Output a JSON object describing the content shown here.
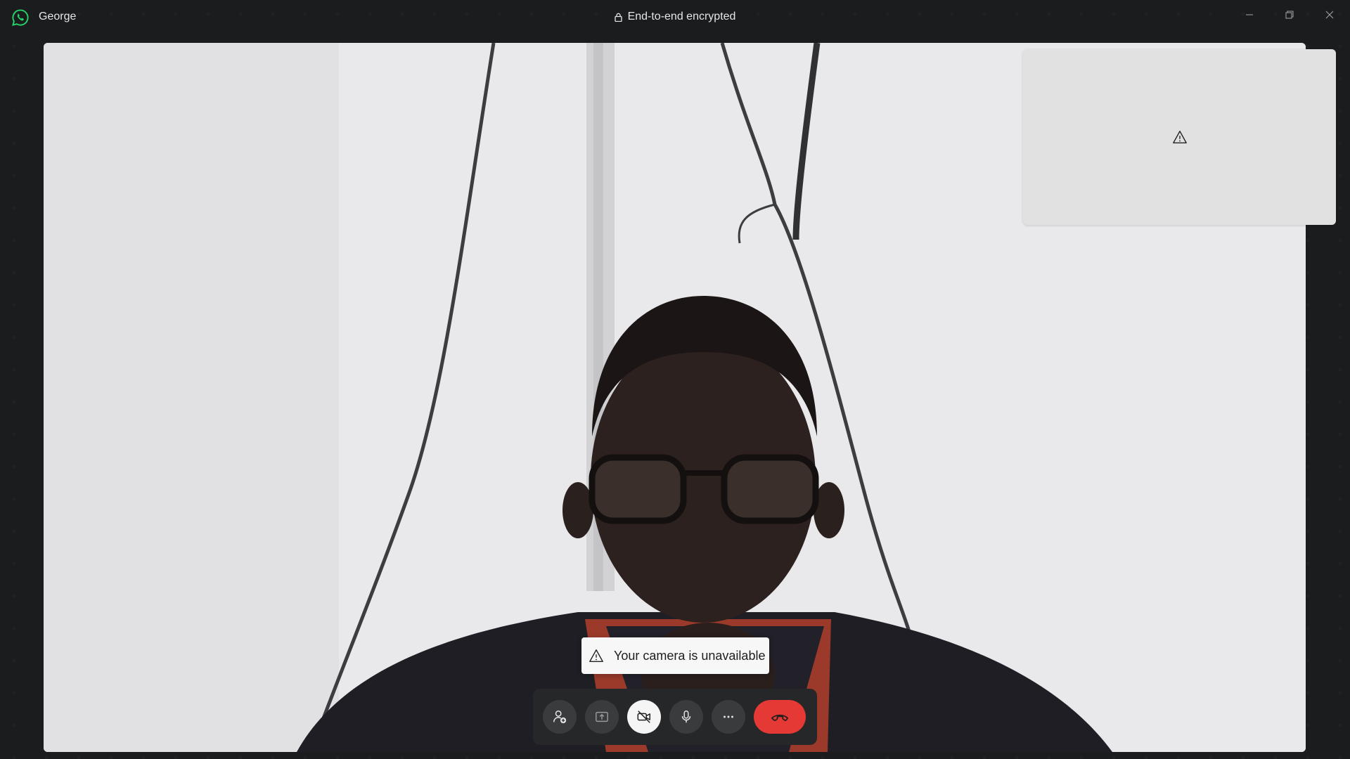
{
  "window": {
    "contact_name": "George",
    "encryption_label": "End-to-end encrypted"
  },
  "self_preview": {
    "icon": "warning-icon"
  },
  "toast": {
    "message": "Your camera is unavailable",
    "icon": "warning-icon"
  },
  "controls": [
    {
      "name": "add-participant-button",
      "icon": "add-person-icon"
    },
    {
      "name": "share-screen-button",
      "icon": "screen-share-icon"
    },
    {
      "name": "camera-toggle-button",
      "icon": "video-off-icon",
      "state": "off"
    },
    {
      "name": "mute-button",
      "icon": "microphone-icon"
    },
    {
      "name": "more-options-button",
      "icon": "more-horizontal-icon"
    },
    {
      "name": "end-call-button",
      "icon": "hang-up-icon"
    }
  ],
  "colors": {
    "brand": "#25d366",
    "end_call": "#e53935",
    "background": "#1b1c1d"
  }
}
